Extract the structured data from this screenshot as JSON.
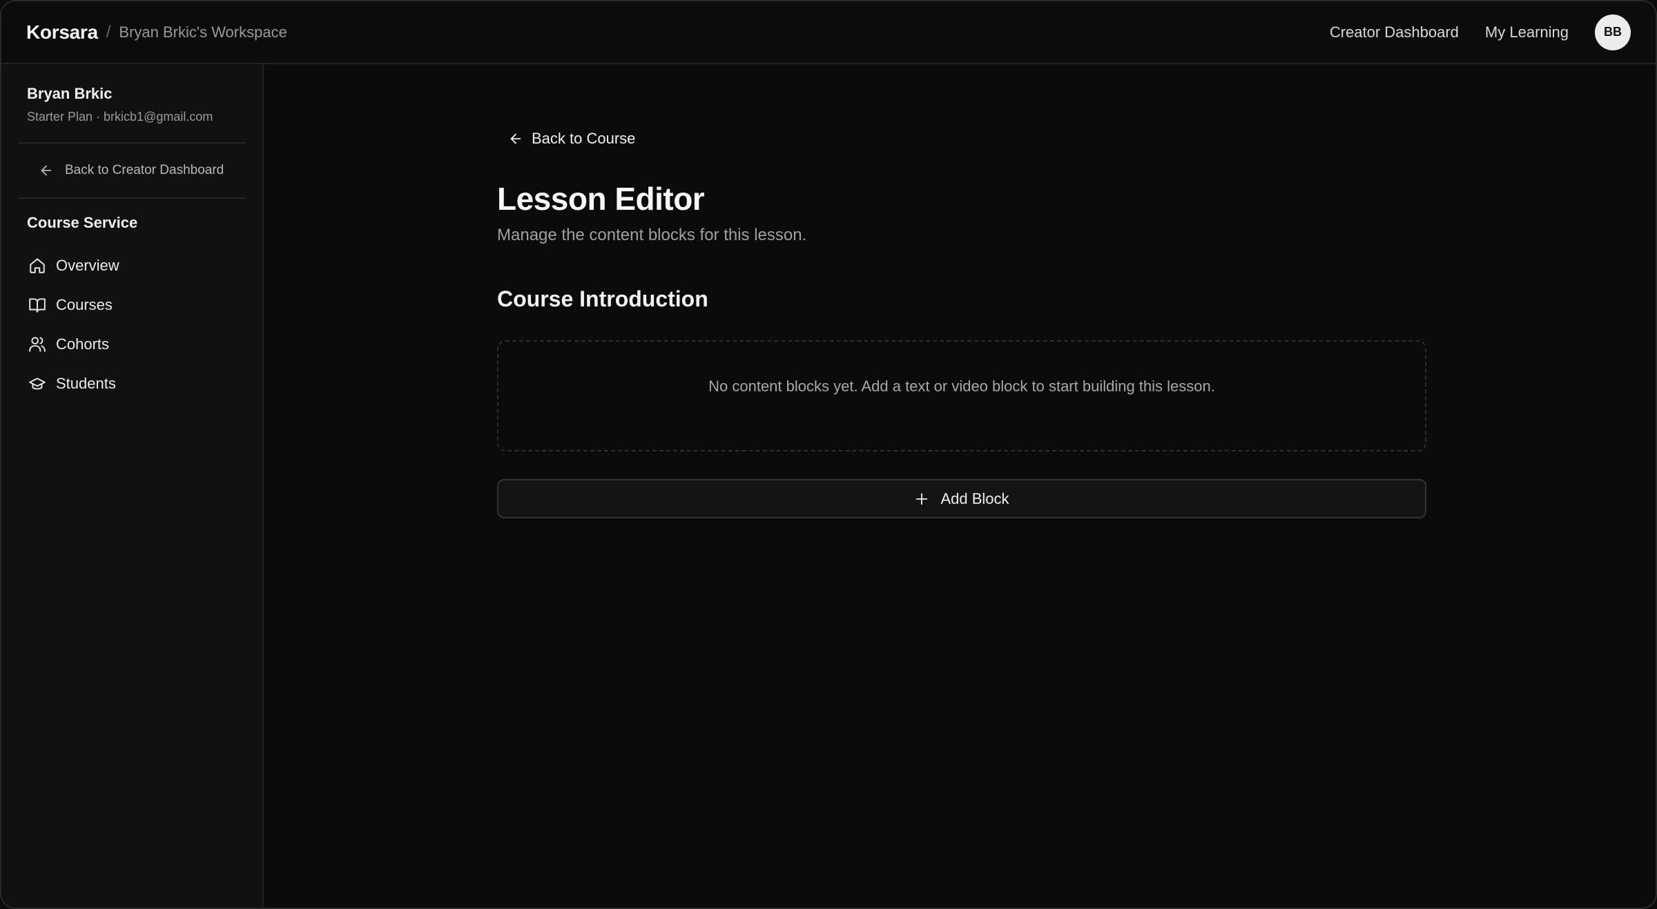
{
  "header": {
    "brand": "Korsara",
    "separator": "/",
    "workspace": "Bryan Brkic's Workspace",
    "nav": [
      "Creator Dashboard",
      "My Learning"
    ],
    "avatar_initials": "BB"
  },
  "sidebar": {
    "user_name": "Bryan Brkic",
    "user_meta": "Starter Plan · brkicb1@gmail.com",
    "back_label": "Back to Creator Dashboard",
    "section_title": "Course Service",
    "items": [
      {
        "label": "Overview",
        "icon": "home-icon"
      },
      {
        "label": "Courses",
        "icon": "book-icon"
      },
      {
        "label": "Cohorts",
        "icon": "users-icon"
      },
      {
        "label": "Students",
        "icon": "graduation-cap-icon"
      }
    ]
  },
  "main": {
    "back_label": "Back to Course",
    "title": "Lesson Editor",
    "subtitle": "Manage the content blocks for this lesson.",
    "lesson_title": "Course Introduction",
    "empty_message": "No content blocks yet. Add a text or video block to start building this lesson.",
    "add_block_label": "Add Block"
  }
}
